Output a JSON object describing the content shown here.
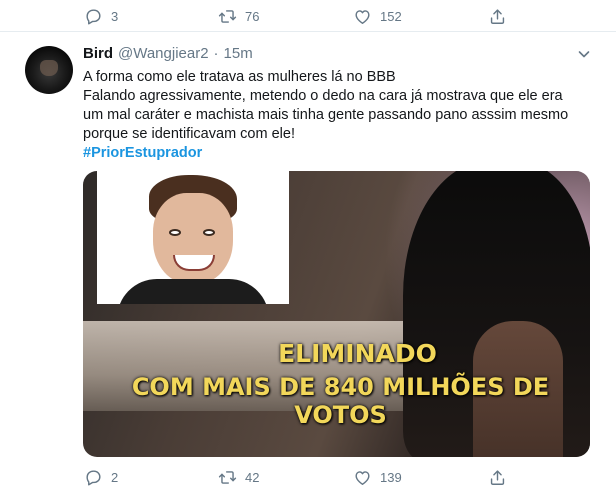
{
  "previous_tweet": {
    "actions": [
      {
        "name": "reply",
        "count": "3"
      },
      {
        "name": "retweet",
        "count": "76"
      },
      {
        "name": "like",
        "count": "152"
      },
      {
        "name": "share",
        "count": ""
      }
    ]
  },
  "tweet": {
    "author_name": "Bird",
    "handle": "@Wangjiear2",
    "separator": "·",
    "time": "15m",
    "text_lines": [
      "A forma como ele tratava as mulheres lá no BBB",
      "Falando agressivamente, metendo o dedo na cara já mostrava que ele era",
      "um mal caráter e machista mais tinha gente passando pano asssim mesmo",
      "porque se identificavam com ele!"
    ],
    "hashtag": "#PriorEstuprador",
    "media": {
      "caption_line1": "ELIMINADO",
      "caption_line2": "COM MAIS DE 840 MILHÕES DE VOTOS"
    },
    "actions": [
      {
        "name": "reply",
        "count": "2"
      },
      {
        "name": "retweet",
        "count": "42"
      },
      {
        "name": "like",
        "count": "139"
      },
      {
        "name": "share",
        "count": ""
      }
    ]
  },
  "colors": {
    "link": "#1b95e0",
    "secondary_text": "#657786",
    "caption": "#f2d75a"
  },
  "icons": [
    "reply-icon",
    "retweet-icon",
    "like-icon",
    "share-icon",
    "chevron-down-icon"
  ]
}
